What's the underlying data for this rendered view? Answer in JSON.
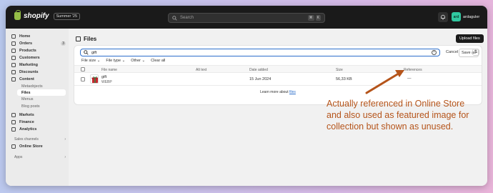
{
  "topbar": {
    "logo_text": "shopify",
    "edition_badge": "Summer '25",
    "search_placeholder": "Search",
    "shortcut_keys": [
      "⌘",
      "K"
    ],
    "user_name": "ardaguler",
    "user_initials": "ard"
  },
  "sidebar": {
    "items": [
      {
        "label": "Home",
        "icon": "home-icon"
      },
      {
        "label": "Orders",
        "icon": "orders-icon",
        "count": "3"
      },
      {
        "label": "Products",
        "icon": "tag-icon"
      },
      {
        "label": "Customers",
        "icon": "person-icon"
      },
      {
        "label": "Marketing",
        "icon": "target-icon"
      },
      {
        "label": "Discounts",
        "icon": "discount-icon"
      },
      {
        "label": "Content",
        "icon": "content-icon"
      }
    ],
    "content_sub": [
      "Metaobjects",
      "Files",
      "Menus",
      "Blog posts"
    ],
    "items2": [
      {
        "label": "Markets",
        "icon": "globe-icon"
      },
      {
        "label": "Finance",
        "icon": "bank-icon"
      },
      {
        "label": "Analytics",
        "icon": "chart-icon"
      }
    ],
    "sales_channels_label": "Sales channels",
    "online_store_label": "Online Store",
    "apps_label": "Apps"
  },
  "main": {
    "title": "Files",
    "upload_button": "Upload files",
    "search_query": "gift",
    "cancel": "Cancel",
    "save_as": "Save as",
    "filters": [
      "File size",
      "File type",
      "Other",
      "Clear all"
    ],
    "columns": [
      "File name",
      "Alt text",
      "Date added",
      "Size",
      "References"
    ],
    "rows": [
      {
        "name": "gift",
        "type": "WEBP",
        "alt": "",
        "date": "15 Jun 2024",
        "size": "56,33 KB",
        "references": "—"
      }
    ],
    "learn_more_prefix": "Learn more about",
    "learn_more_link": "files"
  },
  "annotation": "Actually referenced in Online Store and also used as featured image for collection but shown as unused.",
  "colors": {
    "accent": "#2c6ecb",
    "annotation": "#b5541a",
    "topbar": "#1a1a1a"
  }
}
